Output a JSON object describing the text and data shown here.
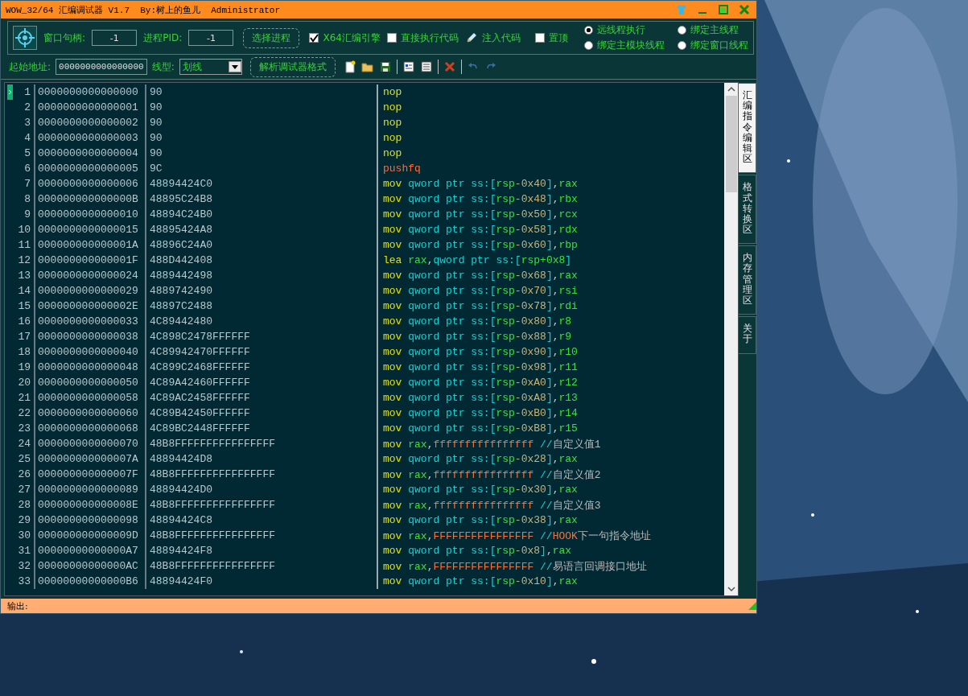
{
  "window": {
    "title": "WOW_32/64 汇编调试器 V1.7  By:树上的鱼儿  Administrator"
  },
  "toolbar": {
    "window_handle": {
      "label": "窗口句柄:",
      "value": "-1"
    },
    "pid": {
      "label": "进程PID:",
      "value": "-1"
    },
    "select_process_button": "选择进程",
    "items": [
      {
        "kind": "checkbox",
        "label": "X64汇编引擎",
        "checked": true
      },
      {
        "kind": "checkbox",
        "label": "直接执行代码",
        "checked": false
      },
      {
        "kind": "action",
        "label": "注入代码"
      },
      {
        "kind": "checkbox",
        "label": "置顶",
        "checked": false
      }
    ],
    "radios": [
      {
        "label": "远线程执行",
        "selected": true
      },
      {
        "label": "绑定主线程",
        "selected": false
      },
      {
        "label": "绑定主模块线程",
        "selected": false
      },
      {
        "label": "绑定窗口线程",
        "selected": false
      }
    ]
  },
  "toolbar2": {
    "start_address": {
      "label": "起始地址:",
      "value": "0000000000000000"
    },
    "line_type": {
      "label": "线型:",
      "value": "划线"
    },
    "parse_button": "解析调试器格式"
  },
  "side_tabs": [
    {
      "label": "汇编指令编辑区",
      "selected": true
    },
    {
      "label": "格式转换区",
      "selected": false
    },
    {
      "label": "内存管理区",
      "selected": false
    },
    {
      "label": "关于",
      "selected": false
    }
  ],
  "rows": [
    {
      "n": "1",
      "address": "0000000000000000",
      "bytes": "90",
      "current": true,
      "code": [
        {
          "kind": "op",
          "text": "nop"
        }
      ]
    },
    {
      "n": "2",
      "address": "0000000000000001",
      "bytes": "90",
      "current": false,
      "code": [
        {
          "kind": "op",
          "text": "nop"
        }
      ]
    },
    {
      "n": "3",
      "address": "0000000000000002",
      "bytes": "90",
      "current": false,
      "code": [
        {
          "kind": "op",
          "text": "nop"
        }
      ]
    },
    {
      "n": "4",
      "address": "0000000000000003",
      "bytes": "90",
      "current": false,
      "code": [
        {
          "kind": "op",
          "text": "nop"
        }
      ]
    },
    {
      "n": "5",
      "address": "0000000000000004",
      "bytes": "90",
      "current": false,
      "code": [
        {
          "kind": "op",
          "text": "nop"
        }
      ]
    },
    {
      "n": "6",
      "address": "0000000000000005",
      "bytes": "9C",
      "current": false,
      "code": [
        {
          "kind": "flagop",
          "text": "pushfq"
        }
      ]
    },
    {
      "n": "7",
      "address": "0000000000000006",
      "bytes": "48894424C0",
      "current": false,
      "code": [
        {
          "kind": "op",
          "text": "mov "
        },
        {
          "kind": "kw",
          "text": "qword ptr ss:"
        },
        {
          "kind": "br",
          "text": "["
        },
        {
          "kind": "reg",
          "text": "rsp"
        },
        {
          "kind": "num",
          "text": "-0x40"
        },
        {
          "kind": "br",
          "text": "]"
        },
        {
          "kind": "punct",
          "text": ","
        },
        {
          "kind": "reg",
          "text": "rax"
        }
      ]
    },
    {
      "n": "8",
      "address": "000000000000000B",
      "bytes": "48895C24B8",
      "current": false,
      "code": [
        {
          "kind": "op",
          "text": "mov "
        },
        {
          "kind": "kw",
          "text": "qword ptr ss:"
        },
        {
          "kind": "br",
          "text": "["
        },
        {
          "kind": "reg",
          "text": "rsp"
        },
        {
          "kind": "num",
          "text": "-0x48"
        },
        {
          "kind": "br",
          "text": "]"
        },
        {
          "kind": "punct",
          "text": ","
        },
        {
          "kind": "reg",
          "text": "rbx"
        }
      ]
    },
    {
      "n": "9",
      "address": "0000000000000010",
      "bytes": "48894C24B0",
      "current": false,
      "code": [
        {
          "kind": "op",
          "text": "mov "
        },
        {
          "kind": "kw",
          "text": "qword ptr ss:"
        },
        {
          "kind": "br",
          "text": "["
        },
        {
          "kind": "reg",
          "text": "rsp"
        },
        {
          "kind": "num",
          "text": "-0x50"
        },
        {
          "kind": "br",
          "text": "]"
        },
        {
          "kind": "punct",
          "text": ","
        },
        {
          "kind": "reg",
          "text": "rcx"
        }
      ]
    },
    {
      "n": "10",
      "address": "0000000000000015",
      "bytes": "48895424A8",
      "current": false,
      "code": [
        {
          "kind": "op",
          "text": "mov "
        },
        {
          "kind": "kw",
          "text": "qword ptr ss:"
        },
        {
          "kind": "br",
          "text": "["
        },
        {
          "kind": "reg",
          "text": "rsp"
        },
        {
          "kind": "num",
          "text": "-0x58"
        },
        {
          "kind": "br",
          "text": "]"
        },
        {
          "kind": "punct",
          "text": ","
        },
        {
          "kind": "reg",
          "text": "rdx"
        }
      ]
    },
    {
      "n": "11",
      "address": "000000000000001A",
      "bytes": "48896C24A0",
      "current": false,
      "code": [
        {
          "kind": "op",
          "text": "mov "
        },
        {
          "kind": "kw",
          "text": "qword ptr ss:"
        },
        {
          "kind": "br",
          "text": "["
        },
        {
          "kind": "reg",
          "text": "rsp"
        },
        {
          "kind": "num",
          "text": "-0x60"
        },
        {
          "kind": "br",
          "text": "]"
        },
        {
          "kind": "punct",
          "text": ","
        },
        {
          "kind": "reg",
          "text": "rbp"
        }
      ]
    },
    {
      "n": "12",
      "address": "000000000000001F",
      "bytes": "488D442408",
      "current": false,
      "code": [
        {
          "kind": "op",
          "text": "lea "
        },
        {
          "kind": "reg",
          "text": "rax"
        },
        {
          "kind": "punct",
          "text": ","
        },
        {
          "kind": "kw",
          "text": "qword ptr ss:"
        },
        {
          "kind": "br",
          "text": "["
        },
        {
          "kind": "reg",
          "text": "rsp+0x8"
        },
        {
          "kind": "br",
          "text": "]"
        }
      ]
    },
    {
      "n": "13",
      "address": "0000000000000024",
      "bytes": "4889442498",
      "current": false,
      "code": [
        {
          "kind": "op",
          "text": "mov "
        },
        {
          "kind": "kw",
          "text": "qword ptr ss:"
        },
        {
          "kind": "br",
          "text": "["
        },
        {
          "kind": "reg",
          "text": "rsp"
        },
        {
          "kind": "num",
          "text": "-0x68"
        },
        {
          "kind": "br",
          "text": "]"
        },
        {
          "kind": "punct",
          "text": ","
        },
        {
          "kind": "reg",
          "text": "rax"
        }
      ]
    },
    {
      "n": "14",
      "address": "0000000000000029",
      "bytes": "4889742490",
      "current": false,
      "code": [
        {
          "kind": "op",
          "text": "mov "
        },
        {
          "kind": "kw",
          "text": "qword ptr ss:"
        },
        {
          "kind": "br",
          "text": "["
        },
        {
          "kind": "reg",
          "text": "rsp"
        },
        {
          "kind": "num",
          "text": "-0x70"
        },
        {
          "kind": "br",
          "text": "]"
        },
        {
          "kind": "punct",
          "text": ","
        },
        {
          "kind": "reg",
          "text": "rsi"
        }
      ]
    },
    {
      "n": "15",
      "address": "000000000000002E",
      "bytes": "48897C2488",
      "current": false,
      "code": [
        {
          "kind": "op",
          "text": "mov "
        },
        {
          "kind": "kw",
          "text": "qword ptr ss:"
        },
        {
          "kind": "br",
          "text": "["
        },
        {
          "kind": "reg",
          "text": "rsp"
        },
        {
          "kind": "num",
          "text": "-0x78"
        },
        {
          "kind": "br",
          "text": "]"
        },
        {
          "kind": "punct",
          "text": ","
        },
        {
          "kind": "reg",
          "text": "rdi"
        }
      ]
    },
    {
      "n": "16",
      "address": "0000000000000033",
      "bytes": "4C89442480",
      "current": false,
      "code": [
        {
          "kind": "op",
          "text": "mov "
        },
        {
          "kind": "kw",
          "text": "qword ptr ss:"
        },
        {
          "kind": "br",
          "text": "["
        },
        {
          "kind": "reg",
          "text": "rsp"
        },
        {
          "kind": "num",
          "text": "-0x80"
        },
        {
          "kind": "br",
          "text": "]"
        },
        {
          "kind": "punct",
          "text": ","
        },
        {
          "kind": "reg",
          "text": "r8"
        }
      ]
    },
    {
      "n": "17",
      "address": "0000000000000038",
      "bytes": "4C898C2478FFFFFF",
      "current": false,
      "code": [
        {
          "kind": "op",
          "text": "mov "
        },
        {
          "kind": "kw",
          "text": "qword ptr ss:"
        },
        {
          "kind": "br",
          "text": "["
        },
        {
          "kind": "reg",
          "text": "rsp"
        },
        {
          "kind": "num",
          "text": "-0x88"
        },
        {
          "kind": "br",
          "text": "]"
        },
        {
          "kind": "punct",
          "text": ","
        },
        {
          "kind": "reg",
          "text": "r9"
        }
      ]
    },
    {
      "n": "18",
      "address": "0000000000000040",
      "bytes": "4C89942470FFFFFF",
      "current": false,
      "code": [
        {
          "kind": "op",
          "text": "mov "
        },
        {
          "kind": "kw",
          "text": "qword ptr ss:"
        },
        {
          "kind": "br",
          "text": "["
        },
        {
          "kind": "reg",
          "text": "rsp"
        },
        {
          "kind": "num",
          "text": "-0x90"
        },
        {
          "kind": "br",
          "text": "]"
        },
        {
          "kind": "punct",
          "text": ","
        },
        {
          "kind": "reg",
          "text": "r10"
        }
      ]
    },
    {
      "n": "19",
      "address": "0000000000000048",
      "bytes": "4C899C2468FFFFFF",
      "current": false,
      "code": [
        {
          "kind": "op",
          "text": "mov "
        },
        {
          "kind": "kw",
          "text": "qword ptr ss:"
        },
        {
          "kind": "br",
          "text": "["
        },
        {
          "kind": "reg",
          "text": "rsp"
        },
        {
          "kind": "num",
          "text": "-0x98"
        },
        {
          "kind": "br",
          "text": "]"
        },
        {
          "kind": "punct",
          "text": ","
        },
        {
          "kind": "reg",
          "text": "r11"
        }
      ]
    },
    {
      "n": "20",
      "address": "0000000000000050",
      "bytes": "4C89A42460FFFFFF",
      "current": false,
      "code": [
        {
          "kind": "op",
          "text": "mov "
        },
        {
          "kind": "kw",
          "text": "qword ptr ss:"
        },
        {
          "kind": "br",
          "text": "["
        },
        {
          "kind": "reg",
          "text": "rsp"
        },
        {
          "kind": "num",
          "text": "-0xA0"
        },
        {
          "kind": "br",
          "text": "]"
        },
        {
          "kind": "punct",
          "text": ","
        },
        {
          "kind": "reg",
          "text": "r12"
        }
      ]
    },
    {
      "n": "21",
      "address": "0000000000000058",
      "bytes": "4C89AC2458FFFFFF",
      "current": false,
      "code": [
        {
          "kind": "op",
          "text": "mov "
        },
        {
          "kind": "kw",
          "text": "qword ptr ss:"
        },
        {
          "kind": "br",
          "text": "["
        },
        {
          "kind": "reg",
          "text": "rsp"
        },
        {
          "kind": "num",
          "text": "-0xA8"
        },
        {
          "kind": "br",
          "text": "]"
        },
        {
          "kind": "punct",
          "text": ","
        },
        {
          "kind": "reg",
          "text": "r13"
        }
      ]
    },
    {
      "n": "22",
      "address": "0000000000000060",
      "bytes": "4C89B42450FFFFFF",
      "current": false,
      "code": [
        {
          "kind": "op",
          "text": "mov "
        },
        {
          "kind": "kw",
          "text": "qword ptr ss:"
        },
        {
          "kind": "br",
          "text": "["
        },
        {
          "kind": "reg",
          "text": "rsp"
        },
        {
          "kind": "num",
          "text": "-0xB0"
        },
        {
          "kind": "br",
          "text": "]"
        },
        {
          "kind": "punct",
          "text": ","
        },
        {
          "kind": "reg",
          "text": "r14"
        }
      ]
    },
    {
      "n": "23",
      "address": "0000000000000068",
      "bytes": "4C89BC2448FFFFFF",
      "current": false,
      "code": [
        {
          "kind": "op",
          "text": "mov "
        },
        {
          "kind": "kw",
          "text": "qword ptr ss:"
        },
        {
          "kind": "br",
          "text": "["
        },
        {
          "kind": "reg",
          "text": "rsp"
        },
        {
          "kind": "num",
          "text": "-0xB8"
        },
        {
          "kind": "br",
          "text": "]"
        },
        {
          "kind": "punct",
          "text": ","
        },
        {
          "kind": "reg",
          "text": "r15"
        }
      ]
    },
    {
      "n": "24",
      "address": "0000000000000070",
      "bytes": "48B8FFFFFFFFFFFFFFFF",
      "current": false,
      "code": [
        {
          "kind": "op",
          "text": "mov "
        },
        {
          "kind": "reg",
          "text": "rax"
        },
        {
          "kind": "punct",
          "text": ","
        },
        {
          "kind": "imm",
          "text": "ffffffffffffffff"
        },
        {
          "kind": "cm",
          "text": " //"
        },
        {
          "kind": "ct",
          "text": "自定义值1"
        }
      ]
    },
    {
      "n": "25",
      "address": "000000000000007A",
      "bytes": "48894424D8",
      "current": false,
      "code": [
        {
          "kind": "op",
          "text": "mov "
        },
        {
          "kind": "kw",
          "text": "qword ptr ss:"
        },
        {
          "kind": "br",
          "text": "["
        },
        {
          "kind": "reg",
          "text": "rsp"
        },
        {
          "kind": "num",
          "text": "-0x28"
        },
        {
          "kind": "br",
          "text": "]"
        },
        {
          "kind": "punct",
          "text": ","
        },
        {
          "kind": "reg",
          "text": "rax"
        }
      ]
    },
    {
      "n": "26",
      "address": "000000000000007F",
      "bytes": "48B8FFFFFFFFFFFFFFFF",
      "current": false,
      "code": [
        {
          "kind": "op",
          "text": "mov "
        },
        {
          "kind": "reg",
          "text": "rax"
        },
        {
          "kind": "punct",
          "text": ","
        },
        {
          "kind": "imm",
          "text": "ffffffffffffffff"
        },
        {
          "kind": "cm",
          "text": " //"
        },
        {
          "kind": "ct",
          "text": "自定义值2"
        }
      ]
    },
    {
      "n": "27",
      "address": "0000000000000089",
      "bytes": "48894424D0",
      "current": false,
      "code": [
        {
          "kind": "op",
          "text": "mov "
        },
        {
          "kind": "kw",
          "text": "qword ptr ss:"
        },
        {
          "kind": "br",
          "text": "["
        },
        {
          "kind": "reg",
          "text": "rsp"
        },
        {
          "kind": "num",
          "text": "-0x30"
        },
        {
          "kind": "br",
          "text": "]"
        },
        {
          "kind": "punct",
          "text": ","
        },
        {
          "kind": "reg",
          "text": "rax"
        }
      ]
    },
    {
      "n": "28",
      "address": "000000000000008E",
      "bytes": "48B8FFFFFFFFFFFFFFFF",
      "current": false,
      "code": [
        {
          "kind": "op",
          "text": "mov "
        },
        {
          "kind": "reg",
          "text": "rax"
        },
        {
          "kind": "punct",
          "text": ","
        },
        {
          "kind": "imm",
          "text": "ffffffffffffffff"
        },
        {
          "kind": "cm",
          "text": " //"
        },
        {
          "kind": "ct",
          "text": "自定义值3"
        }
      ]
    },
    {
      "n": "29",
      "address": "0000000000000098",
      "bytes": "48894424C8",
      "current": false,
      "code": [
        {
          "kind": "op",
          "text": "mov "
        },
        {
          "kind": "kw",
          "text": "qword ptr ss:"
        },
        {
          "kind": "br",
          "text": "["
        },
        {
          "kind": "reg",
          "text": "rsp"
        },
        {
          "kind": "num",
          "text": "-0x38"
        },
        {
          "kind": "br",
          "text": "]"
        },
        {
          "kind": "punct",
          "text": ","
        },
        {
          "kind": "reg",
          "text": "rax"
        }
      ]
    },
    {
      "n": "30",
      "address": "000000000000009D",
      "bytes": "48B8FFFFFFFFFFFFFFFF",
      "current": false,
      "code": [
        {
          "kind": "op",
          "text": "mov "
        },
        {
          "kind": "reg",
          "text": "rax"
        },
        {
          "kind": "punct",
          "text": ","
        },
        {
          "kind": "imm",
          "text": "FFFFFFFFFFFFFFFF"
        },
        {
          "kind": "cm",
          "text": " //"
        },
        {
          "kind": "imm",
          "text": "HOOK"
        },
        {
          "kind": "ct",
          "text": "下一句指令地址"
        }
      ]
    },
    {
      "n": "31",
      "address": "00000000000000A7",
      "bytes": "48894424F8",
      "current": false,
      "code": [
        {
          "kind": "op",
          "text": "mov "
        },
        {
          "kind": "kw",
          "text": "qword ptr ss:"
        },
        {
          "kind": "br",
          "text": "["
        },
        {
          "kind": "reg",
          "text": "rsp"
        },
        {
          "kind": "num",
          "text": "-0x8"
        },
        {
          "kind": "br",
          "text": "]"
        },
        {
          "kind": "punct",
          "text": ","
        },
        {
          "kind": "reg",
          "text": "rax"
        }
      ]
    },
    {
      "n": "32",
      "address": "00000000000000AC",
      "bytes": "48B8FFFFFFFFFFFFFFFF",
      "current": false,
      "code": [
        {
          "kind": "op",
          "text": "mov "
        },
        {
          "kind": "reg",
          "text": "rax"
        },
        {
          "kind": "punct",
          "text": ","
        },
        {
          "kind": "imm",
          "text": "FFFFFFFFFFFFFFFF"
        },
        {
          "kind": "cm",
          "text": " //"
        },
        {
          "kind": "ct",
          "text": "易语言回调接口地址"
        }
      ]
    },
    {
      "n": "33",
      "address": "00000000000000B6",
      "bytes": "48894424F0",
      "current": false,
      "code": [
        {
          "kind": "op",
          "text": "mov "
        },
        {
          "kind": "kw",
          "text": "qword ptr ss:"
        },
        {
          "kind": "br",
          "text": "["
        },
        {
          "kind": "reg",
          "text": "rsp"
        },
        {
          "kind": "num",
          "text": "-0x10"
        },
        {
          "kind": "br",
          "text": "]"
        },
        {
          "kind": "punct",
          "text": ","
        },
        {
          "kind": "reg",
          "text": "rax"
        }
      ]
    }
  ],
  "output": {
    "label": "输出:"
  }
}
